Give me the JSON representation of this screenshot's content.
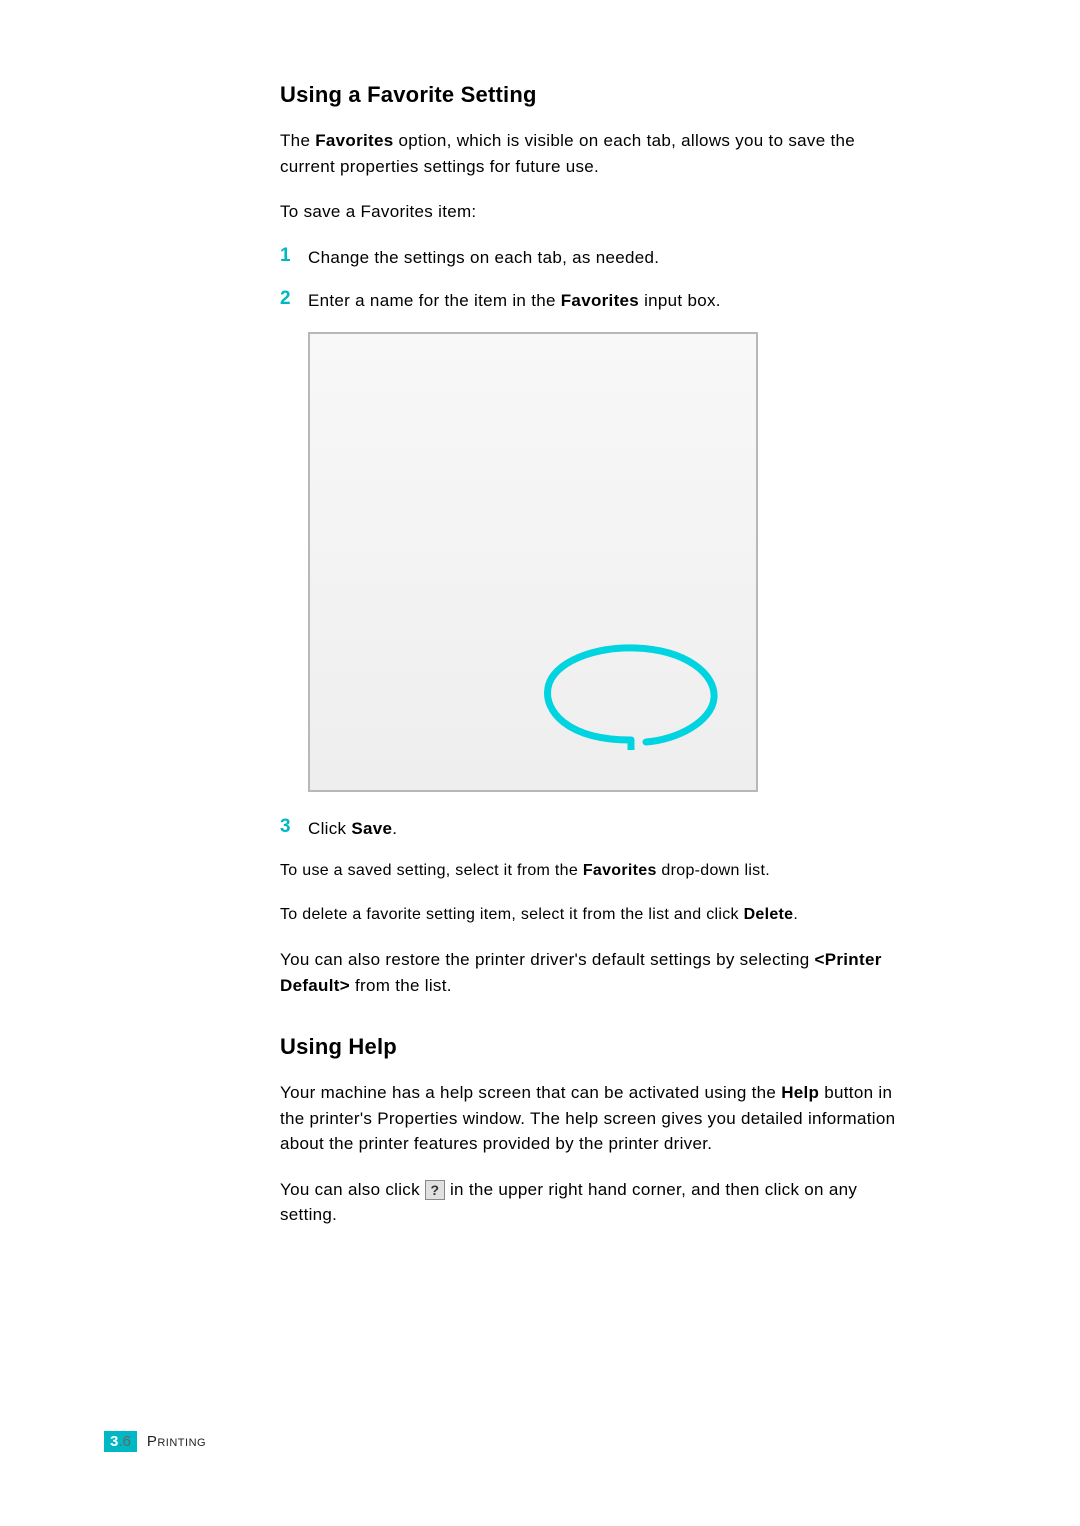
{
  "section1": {
    "heading": "Using a Favorite Setting",
    "para1_a": "The ",
    "para1_b": "Favorites",
    "para1_c": " option, which is visible on each tab, allows you to save the current properties settings for future use.",
    "para2": "To save a Favorites item:",
    "steps": {
      "s1_num": "1",
      "s1_text": "Change the settings on each tab, as needed.",
      "s2_num": "2",
      "s2_text_a": "Enter a name for the item in the ",
      "s2_text_b": "Favorites",
      "s2_text_c": " input box.",
      "s3_num": "3",
      "s3_text_a": "Click ",
      "s3_text_b": "Save",
      "s3_text_c": "."
    },
    "after1_a": "To use a saved setting, select it from the ",
    "after1_b": "Favorites",
    "after1_c": " drop-down list.",
    "after2_a": "To delete a favorite setting item, select it from the list and click ",
    "after2_b": "Delete",
    "after2_c": ".",
    "after3_a": "You can also restore the printer driver's default settings by selecting ",
    "after3_b": "<Printer Default>",
    "after3_c": " from the list."
  },
  "section2": {
    "heading": "Using Help",
    "para1_a": "Your machine has a help screen that can be activated using the ",
    "para1_b": "Help",
    "para1_c": " button in the printer's Properties window. The help screen gives you detailed information about the printer features provided by the printer driver.",
    "para2_a": "You can also click ",
    "help_icon_label": "?",
    "para2_b": " in the upper right hand corner, and then click on any setting."
  },
  "footer": {
    "chapter": "3",
    "page": ".6",
    "title": "Printing"
  }
}
